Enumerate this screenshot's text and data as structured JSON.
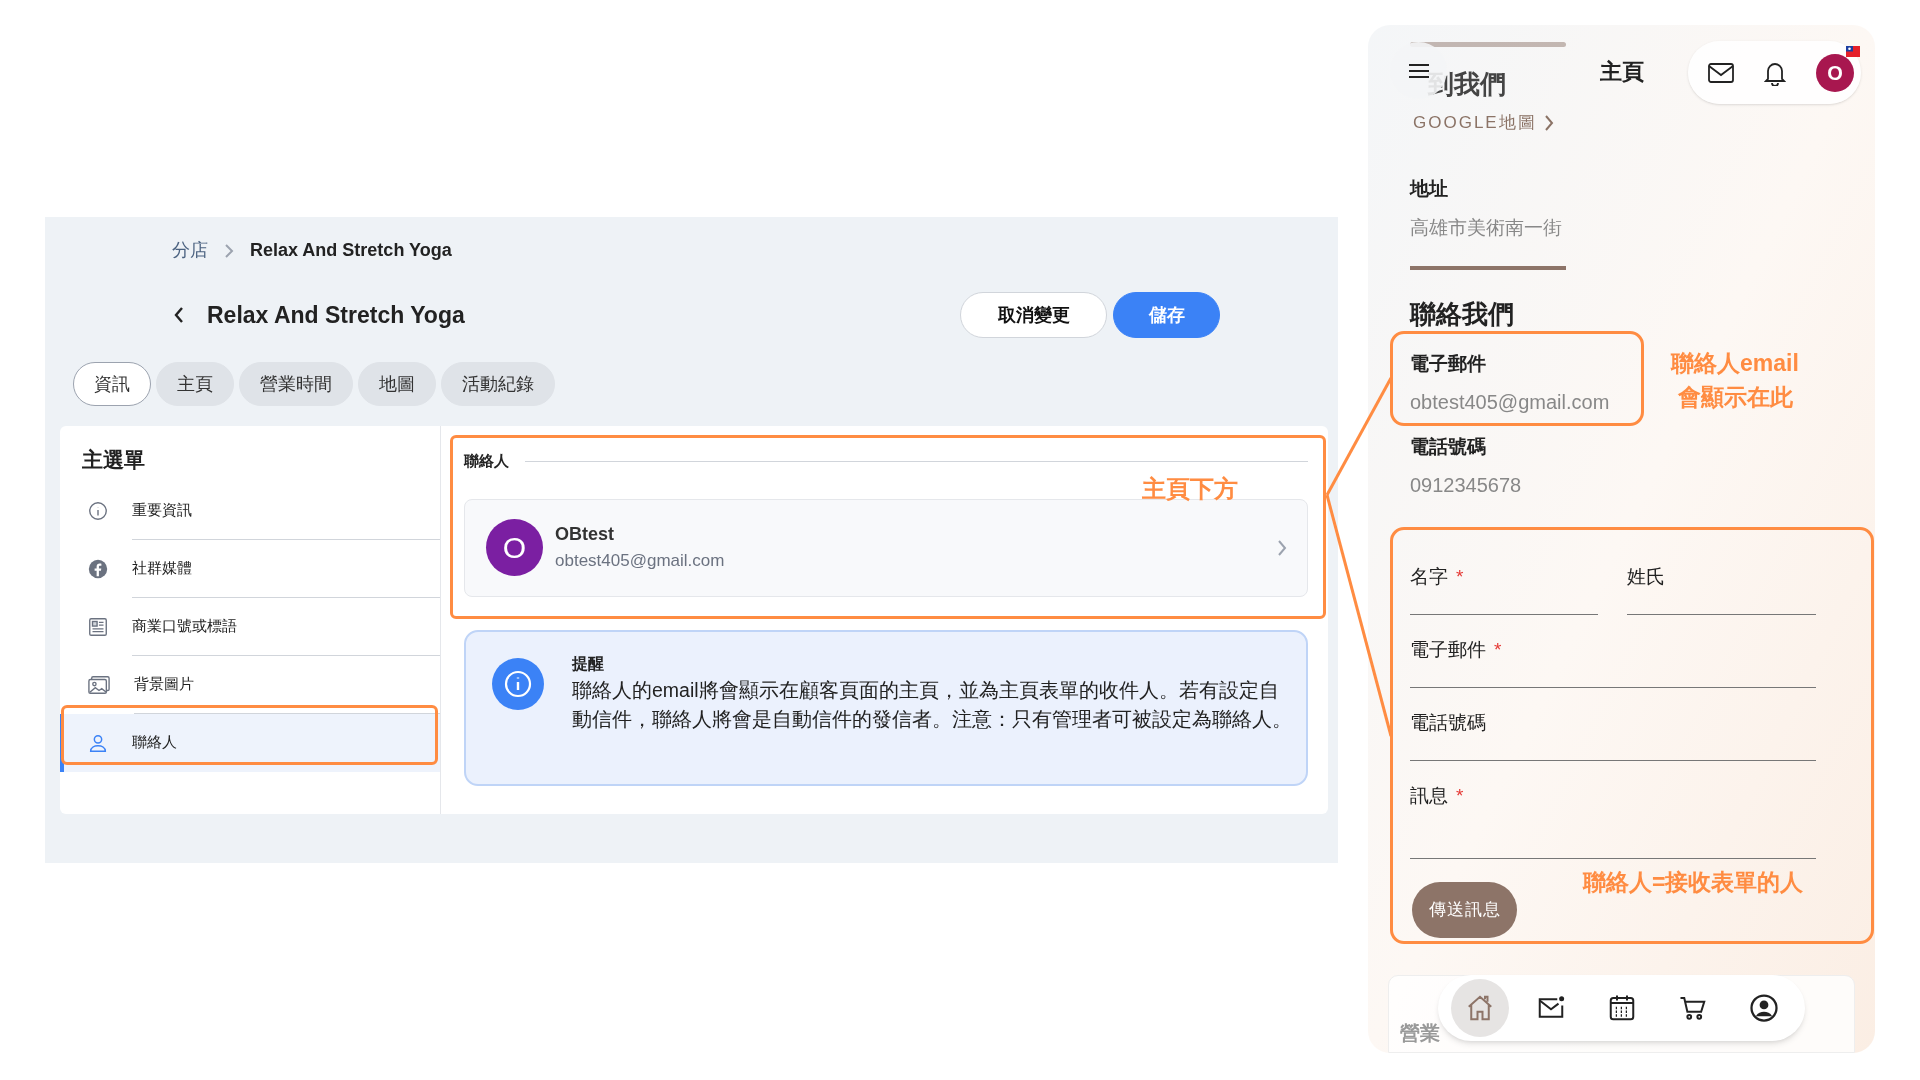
{
  "admin": {
    "breadcrumb": [
      "分店",
      "Relax And Stretch Yoga"
    ],
    "title": "Relax And Stretch Yoga",
    "buttons": [
      {
        "label": "取消變更",
        "kind": "secondary"
      },
      {
        "label": "儲存",
        "kind": "primary"
      }
    ],
    "tabs": [
      {
        "label": "資訊",
        "selected": true
      },
      {
        "label": "主頁",
        "selected": false
      },
      {
        "label": "營業時間",
        "selected": false
      },
      {
        "label": "地圖",
        "selected": false
      },
      {
        "label": "活動紀錄",
        "selected": false
      }
    ],
    "sidebar": {
      "title": "主選單",
      "items": [
        {
          "label": "重要資訊",
          "selected": false
        },
        {
          "label": "社群媒體",
          "selected": false
        },
        {
          "label": "商業口號或標語",
          "selected": false
        },
        {
          "label": "背景圖片",
          "selected": false
        },
        {
          "label": "聯絡人",
          "selected": true
        }
      ]
    },
    "contact_section": {
      "heading": "聯絡人",
      "contact": {
        "initial": "O",
        "name": "OBtest",
        "email": "obtest405@gmail.com"
      }
    },
    "notice": {
      "title": "提醒",
      "text": "聯絡人的email將會顯示在顧客頁面的主頁，並為主頁表單的收件人。若有設定自動信件，聯絡人將會是自動信件的發信者。注意：只有管理者可被設定為聯絡人。"
    }
  },
  "phone": {
    "header": {
      "title": "主頁",
      "avatar": "O"
    },
    "blurred_heading": "到我們",
    "map_link": "GOOGLE地圖",
    "address": {
      "label": "地址",
      "value": "高雄市美術南一街"
    },
    "contact_title": "聯絡我們",
    "email": {
      "label": "電子郵件",
      "value": "obtest405@gmail.com"
    },
    "phone": {
      "label": "電話號碼",
      "value": "0912345678"
    },
    "form": {
      "fields": [
        {
          "label": "名字",
          "required_mark": "*"
        },
        {
          "label": "姓氏"
        },
        {
          "label": "電子郵件",
          "required_mark": "*"
        },
        {
          "label": "電話號碼"
        },
        {
          "label": "訊息",
          "required_mark": "*"
        }
      ],
      "submit": "傳送訊息"
    },
    "faded_text": "營業",
    "nav": [
      {
        "selected": true
      },
      {
        "selected": false
      },
      {
        "selected": false
      },
      {
        "selected": false
      },
      {
        "selected": false
      }
    ]
  },
  "annotations": [
    "主頁下方",
    "聯絡人email\n會顯示在此",
    "聯絡人=接收表單的人"
  ]
}
